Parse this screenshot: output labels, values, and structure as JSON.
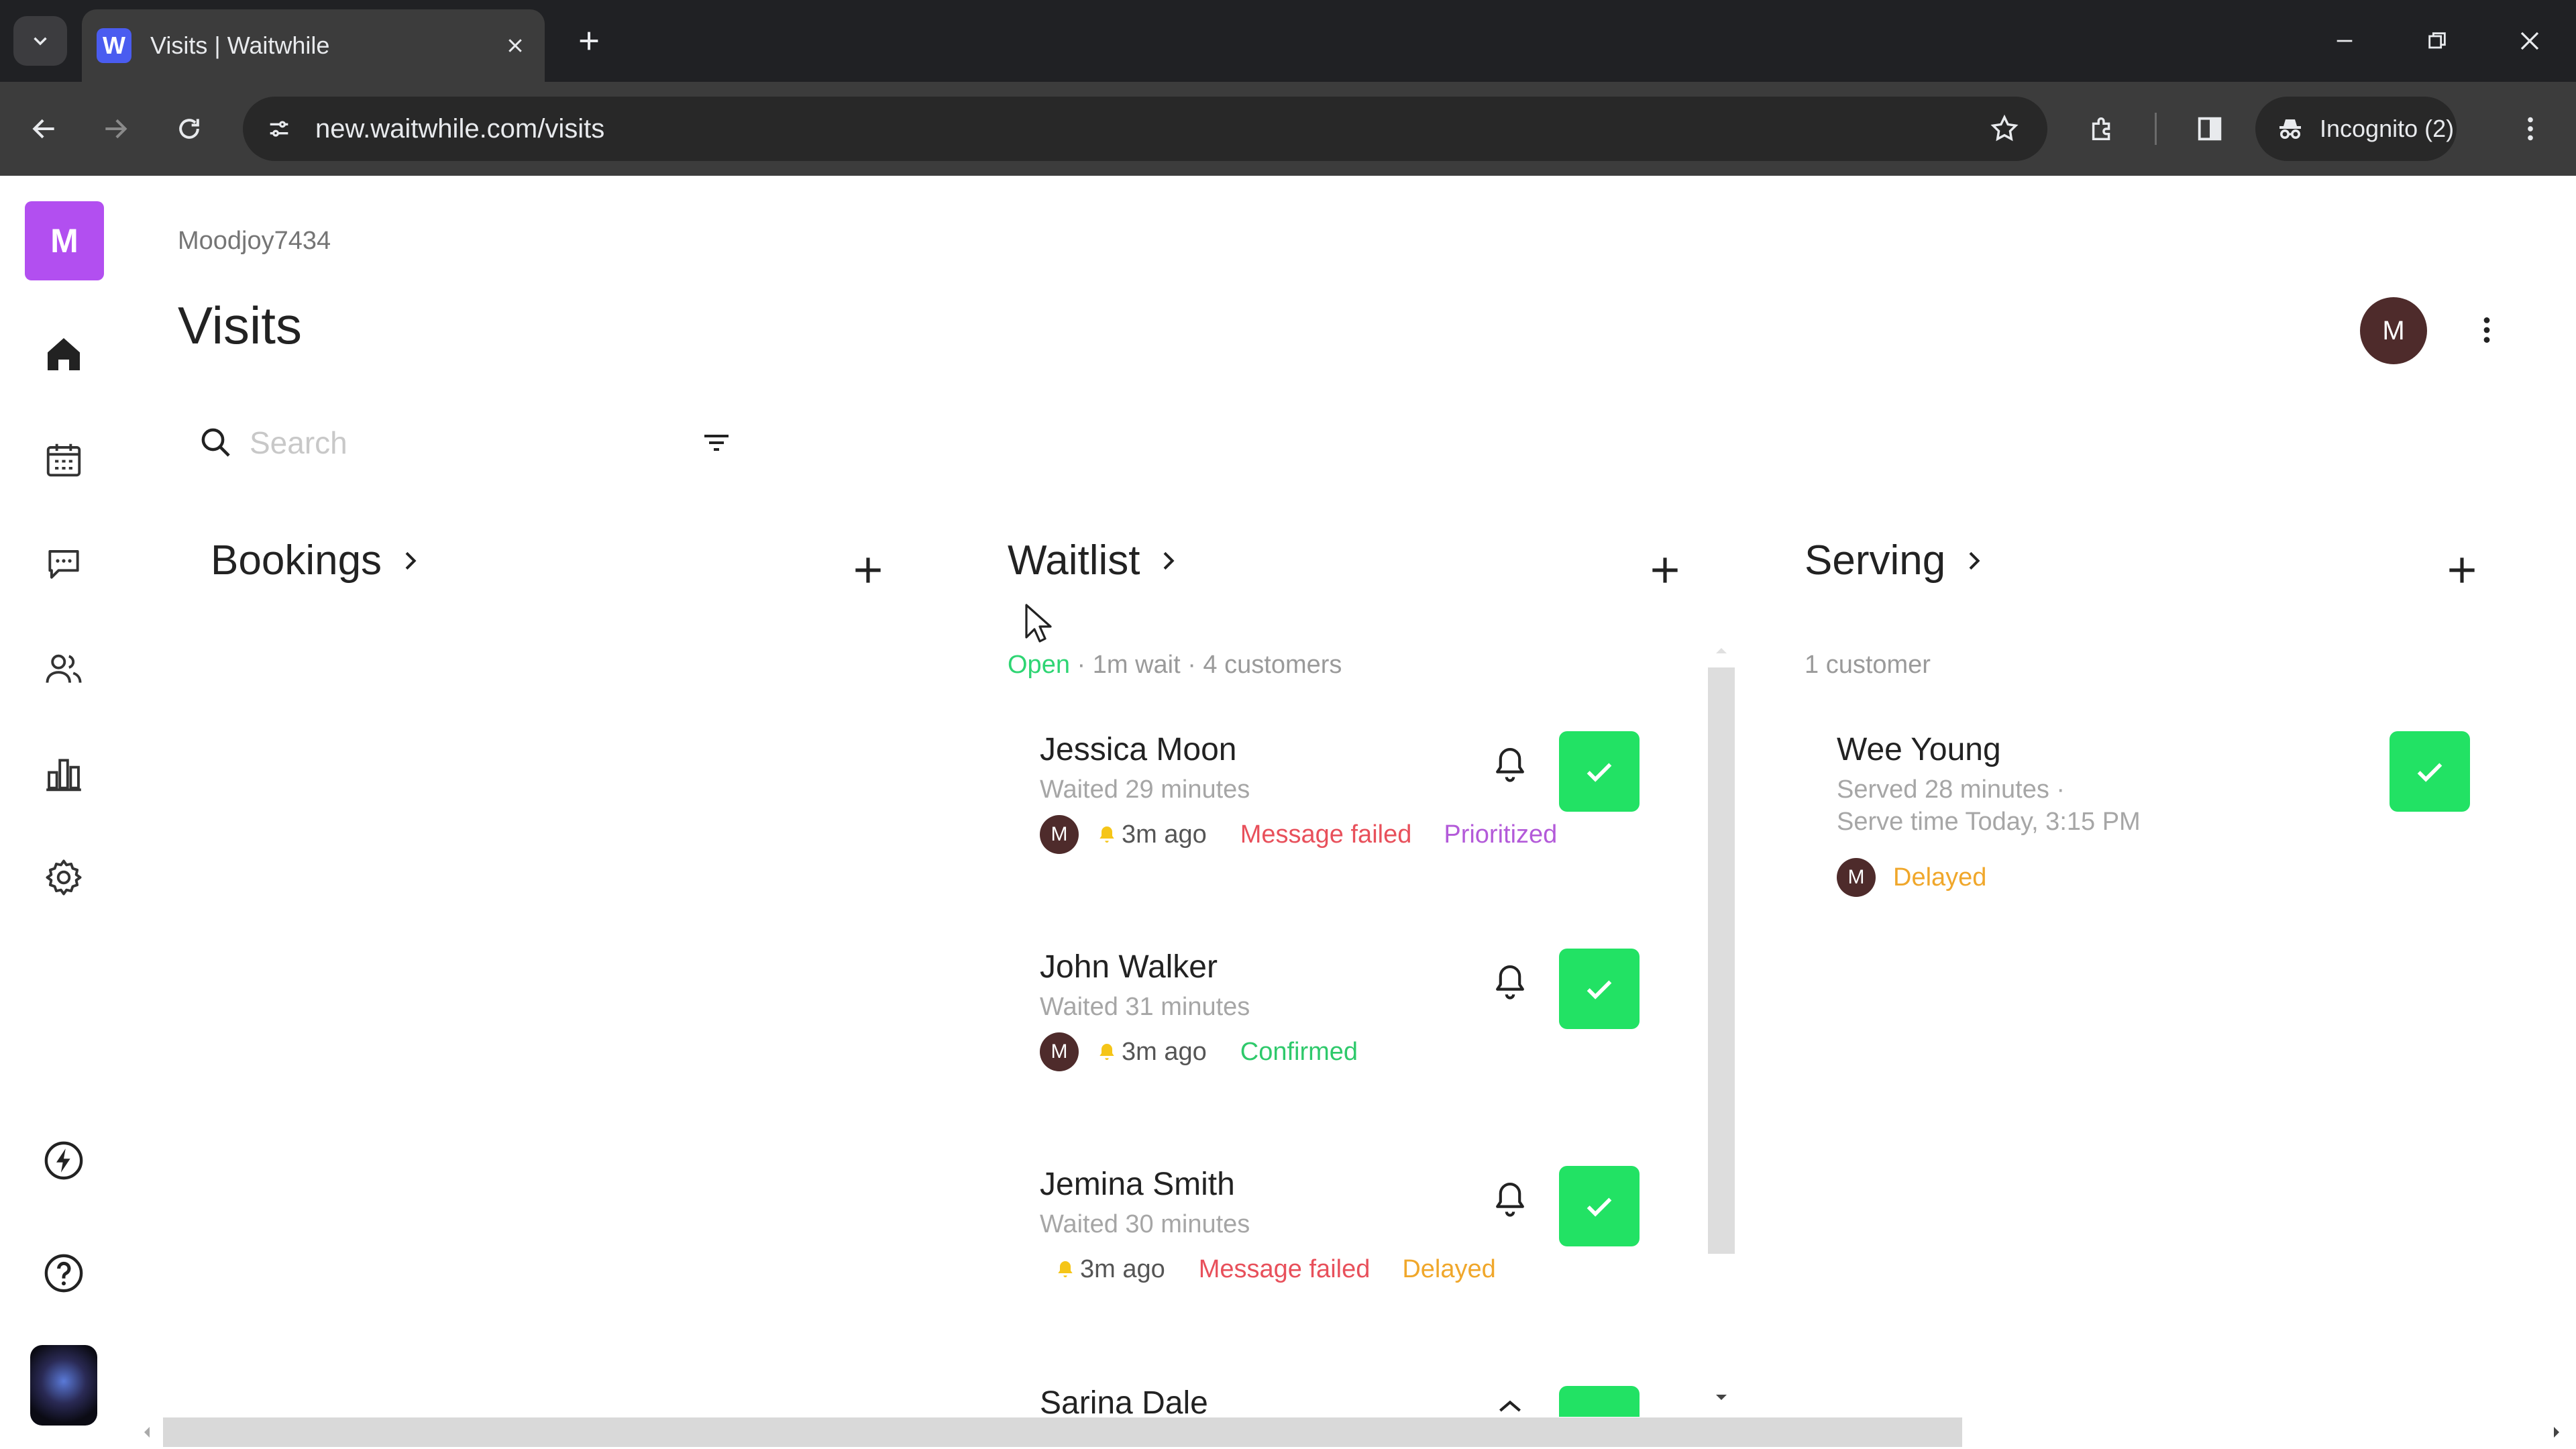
{
  "browser": {
    "tab_title": "Visits | Waitwhile",
    "favicon_letter": "W",
    "url": "new.waitwhile.com/visits",
    "incognito_label": "Incognito (2)"
  },
  "sidebar": {
    "logo_letter": "M",
    "items": [
      {
        "name": "home",
        "icon": "home-icon"
      },
      {
        "name": "calendar",
        "icon": "calendar-icon"
      },
      {
        "name": "messages",
        "icon": "chat-icon"
      },
      {
        "name": "customers",
        "icon": "users-icon"
      },
      {
        "name": "analytics",
        "icon": "bar-chart-icon"
      },
      {
        "name": "settings",
        "icon": "gear-icon"
      }
    ],
    "bottom": [
      {
        "name": "whats-new",
        "icon": "lightning-icon"
      },
      {
        "name": "help",
        "icon": "help-icon"
      }
    ]
  },
  "header": {
    "account_name": "Moodjoy7434",
    "title": "Visits",
    "avatar_letter": "M"
  },
  "search": {
    "placeholder": "Search"
  },
  "columns": {
    "bookings": {
      "title": "Bookings"
    },
    "waitlist": {
      "title": "Waitlist",
      "status": "Open",
      "summary": " · 1m wait · 4 customers",
      "items": [
        {
          "name": "Jessica Moon",
          "waited": "Waited 29 minutes",
          "avatar": "M",
          "notified": "3m ago",
          "tags": [
            "Message failed",
            "Prioritized"
          ]
        },
        {
          "name": "John Walker",
          "waited": "Waited 31 minutes",
          "avatar": "M",
          "notified": "3m ago",
          "tags": [
            "Confirmed"
          ]
        },
        {
          "name": "Jemina Smith",
          "waited": "Waited 30 minutes",
          "avatar": "",
          "notified": "3m ago",
          "tags": [
            "Message failed",
            "Delayed"
          ]
        },
        {
          "name": "Sarina Dale"
        }
      ]
    },
    "serving": {
      "title": "Serving",
      "summary": "1 customer",
      "items": [
        {
          "name": "Wee Young",
          "served": "Served 28 minutes ·",
          "serve_time": "Serve time Today, 3:15 PM",
          "avatar": "M",
          "tags": [
            "Delayed"
          ]
        }
      ]
    }
  },
  "colors": {
    "accent_green": "#22e264",
    "logo_purple": "#b24ff0",
    "failed_red": "#e8505b",
    "prioritized_purple": "#b35ad9",
    "confirmed_green": "#2ec96b",
    "delayed_orange": "#f0a72b"
  }
}
